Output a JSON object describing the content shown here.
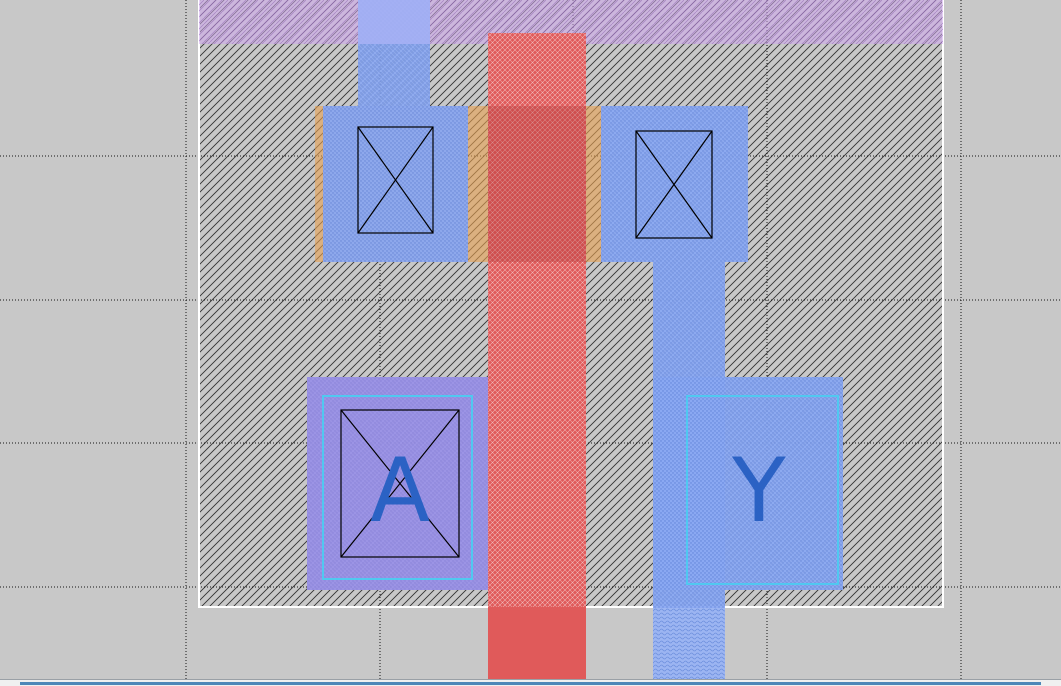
{
  "viewer": {
    "background_color": "#c8c8c8",
    "grid_color": "#000000"
  },
  "cell": {
    "boundary_color": "#ffffff",
    "hatch_color": "#000000"
  },
  "layers": {
    "poly": {
      "name": "poly",
      "color": "#e05a5a"
    },
    "metal1": {
      "name": "metal1",
      "color": "#7f9ff0"
    },
    "diffusion": {
      "name": "diffusion",
      "color": "#e8a050"
    },
    "nwell": {
      "name": "nwell",
      "color": "#c8a0e0"
    },
    "pin_outline": {
      "name": "pin outline",
      "color": "#50c8f0"
    }
  },
  "pins": {
    "a": {
      "label": "A"
    },
    "y": {
      "label": "Y"
    }
  },
  "icons": {
    "contact": "contact-cross-icon"
  }
}
